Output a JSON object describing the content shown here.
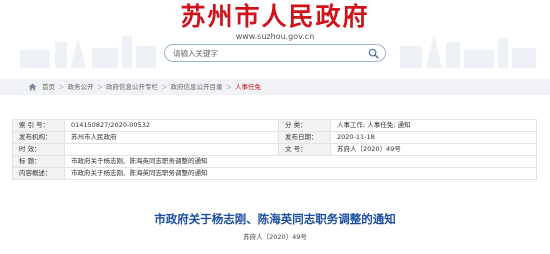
{
  "header": {
    "site_title": "苏州市人民政府",
    "site_url": "www.suzhou.gov.cn",
    "search_placeholder": "请输入关键字"
  },
  "breadcrumb": {
    "items": [
      "首页",
      "政务公开",
      "政府信息公开专栏",
      "政府信息公开目录",
      "人事任免"
    ],
    "separator": "＞"
  },
  "info": {
    "index_label": "索    引    号：",
    "index_value": "014150827/2020-00532",
    "category_label": "分        类：",
    "category_value": "人事工作;  人事任免;  通知",
    "publisher_label": "发布机构：",
    "publisher_value": "苏州市人民政府",
    "date_label": "发布日期：",
    "date_value": "2020-11-18",
    "validity_label": "时        效：",
    "validity_value": "",
    "docno_label": "文        号：",
    "docno_value": "苏府人〔2020〕49号",
    "title_label": "标        题：",
    "title_value": "市政府关于杨志刚、陈海英同志职务调整的通知",
    "summary_label": "内容概述：",
    "summary_value": "市政府关于杨志刚、陈海英同志职务调整的通知"
  },
  "article": {
    "title": "市政府关于杨志刚、陈海英同志职务调整的通知",
    "doc_number": "苏府人〔2020〕49号"
  },
  "colors": {
    "brand_red": "#d0121b",
    "title_blue": "#1b4ea0",
    "breadcrumb_bg": "#f0f2f6",
    "label_bg": "#f3f3f3"
  }
}
